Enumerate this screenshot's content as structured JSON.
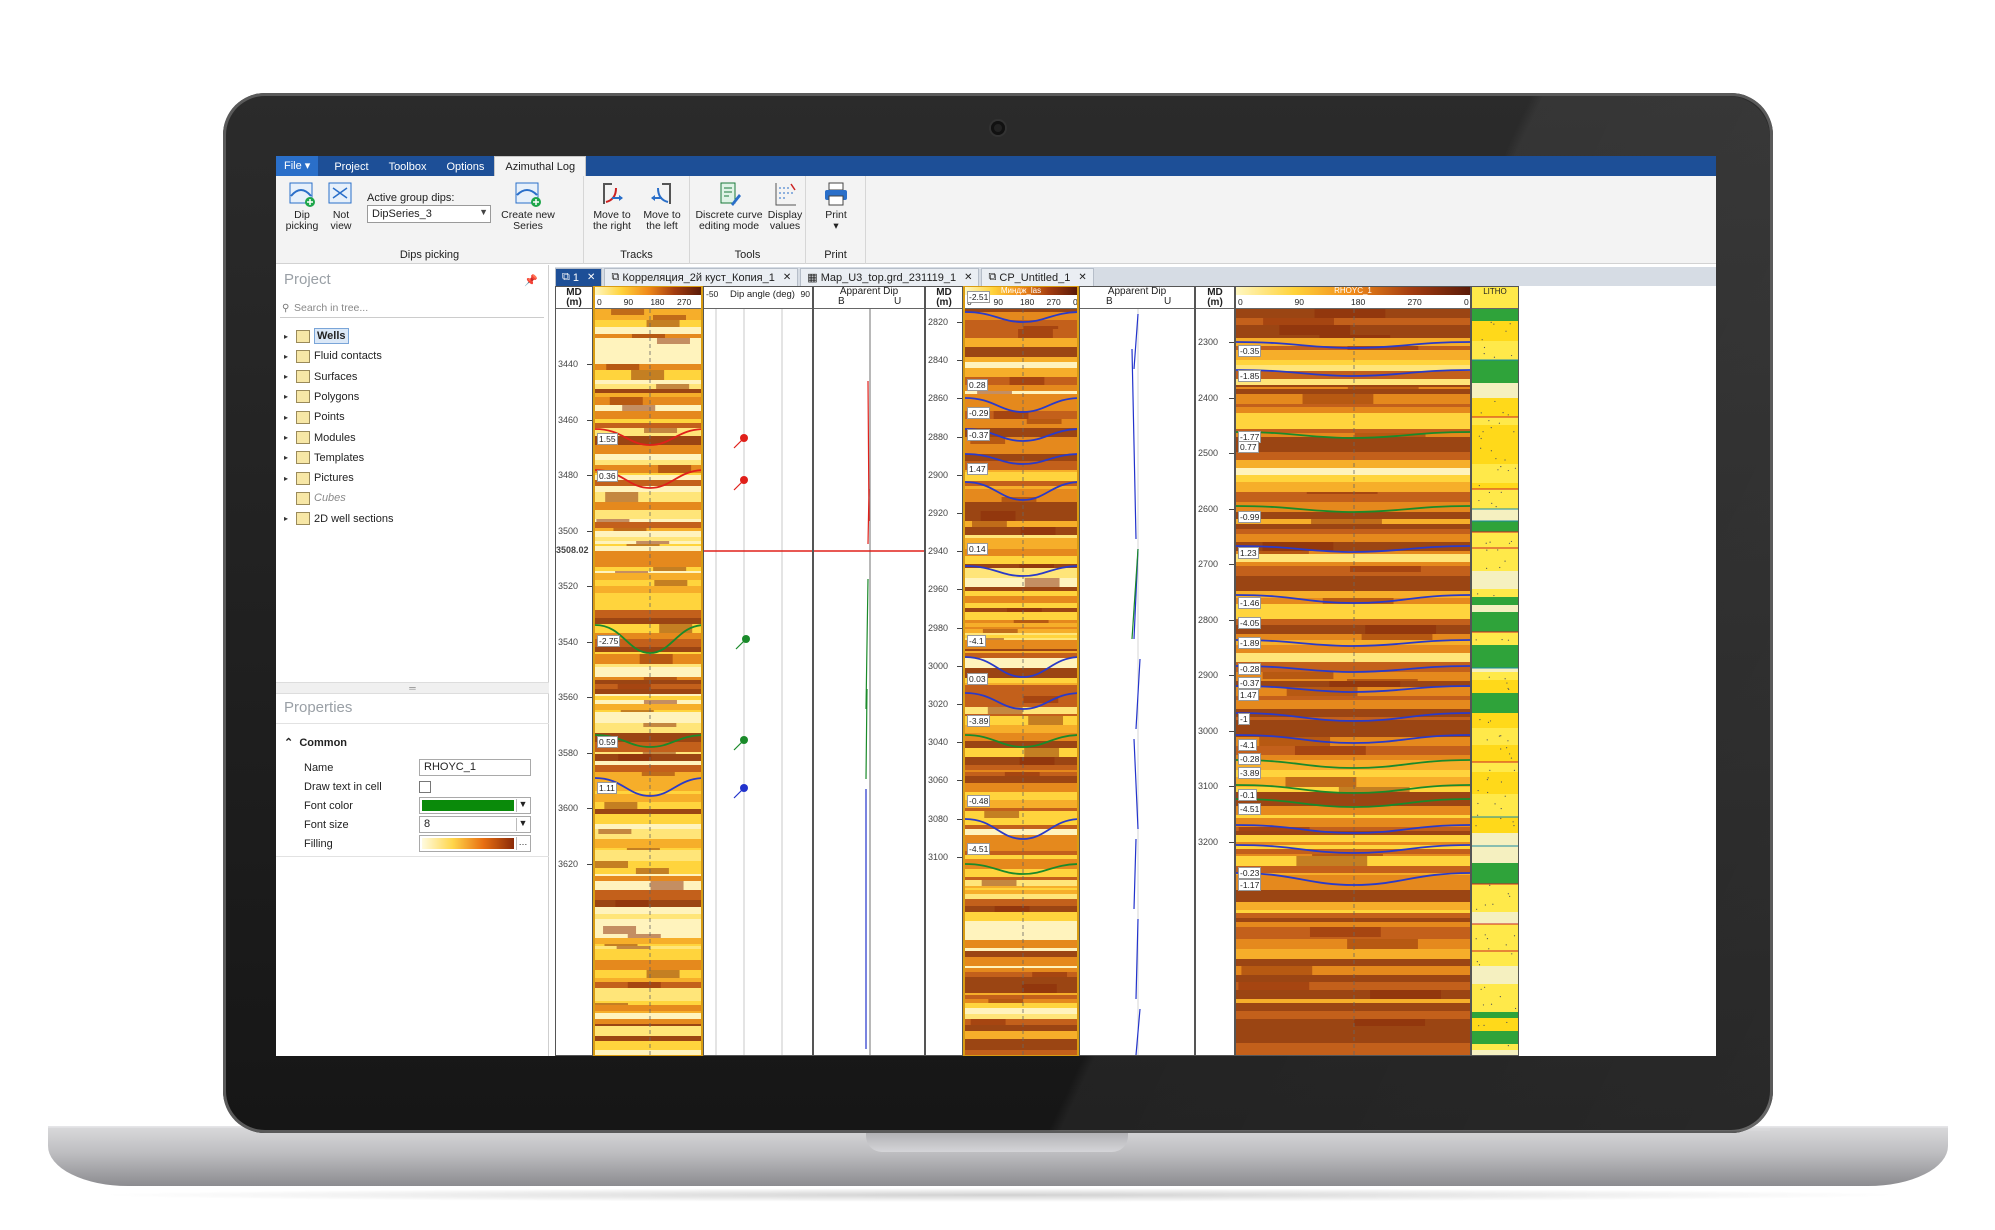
{
  "menu": {
    "file": "File",
    "tabs": [
      "Project",
      "Toolbox",
      "Options",
      "Azimuthal Log"
    ]
  },
  "ribbon": {
    "dip_picking": "Dip picking",
    "not_view": "Not view",
    "active_group_label": "Active group dips:",
    "active_group_value": "DipSeries_3",
    "create_new_series": "Create new Series",
    "group_dips": "Dips picking",
    "move_right": "Move to the right",
    "move_left": "Move to the left",
    "group_tracks": "Tracks",
    "discrete_curve": "Discrete curve editing mode",
    "display_values": "Display values",
    "group_tools": "Tools",
    "print": "Print",
    "group_print": "Print"
  },
  "project": {
    "title": "Project",
    "search_placeholder": "Search in tree...",
    "items": [
      "Wells",
      "Fluid contacts",
      "Surfaces",
      "Polygons",
      "Points",
      "Modules",
      "Templates",
      "Pictures",
      "Cubes",
      "2D well sections"
    ]
  },
  "properties": {
    "title": "Properties",
    "section": "Common",
    "name_label": "Name",
    "name_value": "RHOYC_1",
    "draw_text_label": "Draw text in cell",
    "font_color_label": "Font color",
    "font_color": "#0a8a0a",
    "font_size_label": "Font size",
    "font_size_value": "8",
    "filling_label": "Filling"
  },
  "doc_tabs": [
    "1",
    "Корреляция_2й куст_Копия_1",
    "Map_U3_top.grd_231119_1",
    "CP_Untitled_1"
  ],
  "well1": {
    "md_header": "MD",
    "md_unit": "(m)",
    "depths": [
      "3440",
      "3460",
      "3480",
      "3500",
      "3520",
      "3540",
      "3560",
      "3580",
      "3600",
      "3620"
    ],
    "cursor_depth": "3508.02",
    "azimuth_ticks": [
      "0",
      "90",
      "180",
      "270"
    ],
    "dip_angle_header": "Dip angle (deg)",
    "dip_ticks": [
      "-50",
      "90"
    ],
    "apparent_header": "Apparent Dip",
    "apparent_b": "B",
    "apparent_u": "U",
    "dip_values": [
      "1.55",
      "0.36",
      "-2.75",
      "0.59",
      "1.11"
    ]
  },
  "well2": {
    "md_header": "MD",
    "md_unit": "(m)",
    "depths": [
      "2820",
      "2840",
      "2860",
      "2880",
      "2900",
      "2920",
      "2940",
      "2960",
      "2980",
      "3000",
      "3020",
      "3040",
      "3060",
      "3080",
      "3100"
    ],
    "curve_name": "Миндж_las",
    "azimuth_ticks": [
      "0",
      "90",
      "180",
      "270",
      "0"
    ],
    "apparent_header": "Apparent Dip",
    "apparent_b": "B",
    "apparent_u": "U",
    "dip_values": [
      "-2.51",
      "0.28",
      "-0.29",
      "-0.37",
      "1.47",
      "0.14",
      "-4.1",
      "0.03",
      "-3.89",
      "-0.48",
      "-4.51"
    ]
  },
  "well3": {
    "md_header": "MD",
    "md_unit": "(m)",
    "depths": [
      "2300",
      "2400",
      "2500",
      "2600",
      "2700",
      "2800",
      "2900",
      "3000",
      "3100",
      "3200"
    ],
    "curve_name": "RHOYC_1",
    "lith_name": "LITHO",
    "azimuth_ticks": [
      "0",
      "90",
      "180",
      "270",
      "0"
    ],
    "dip_values": [
      "-0.35",
      "-1.85",
      "-1.77",
      "0.77",
      "-0.99",
      "1.23",
      "-1.46",
      "-4.05",
      "-1.89",
      "-0.28",
      "-0.37",
      "1.47",
      "-1",
      "-4.1",
      "-0.28",
      "-3.89",
      "-0.1",
      "-4.51",
      "-0.23",
      "-1.17"
    ]
  }
}
